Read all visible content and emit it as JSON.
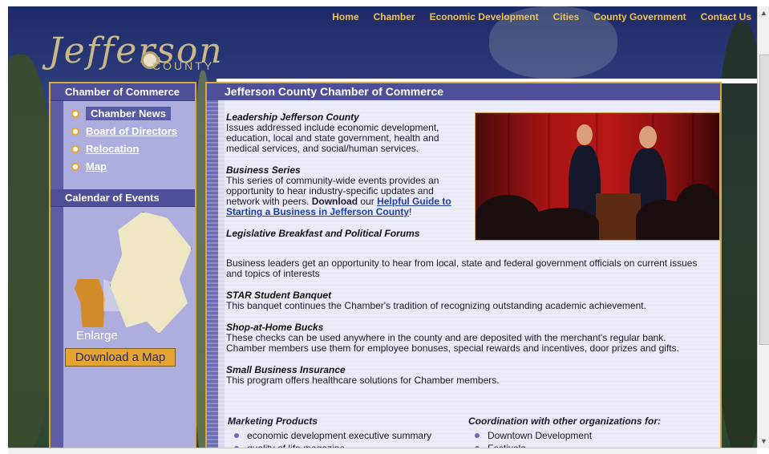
{
  "nav": {
    "items": [
      "Home",
      "Chamber",
      "Economic Development",
      "Cities",
      "County Government",
      "Contact Us"
    ]
  },
  "logo": {
    "script": "Jefferson",
    "county": "COUNTY"
  },
  "sidebar": {
    "heading": "Chamber of Commerce",
    "items": [
      {
        "label": "Chamber News",
        "active": true
      },
      {
        "label": "Board of Directors",
        "active": false
      },
      {
        "label": "Relocation",
        "active": false
      },
      {
        "label": "Map",
        "active": false
      }
    ],
    "calendar_heading": "Calendar of Events",
    "enlarge_label": "Enlarge",
    "download_map_label": "Download a Map"
  },
  "main": {
    "title": "Jefferson County Chamber of Commerce",
    "sections": [
      {
        "title": "Leadership Jefferson County",
        "text": "Issues addressed include economic development, education, local and state government, health and medical services, and social/human services."
      },
      {
        "title": "Business Series",
        "text_before": "This series of community-wide events provides an opportunity to hear industry-specific updates and network with peers. ",
        "download_word": "Download",
        "text_mid": " our ",
        "link": "Helpful Guide to Starting a Business in Jefferson County",
        "text_after": "!"
      },
      {
        "title": "Legislative Breakfast and Political Forums",
        "text": "Business leaders get an opportunity to hear from local, state and federal government officials on current issues and topics of interests"
      },
      {
        "title": "STAR Student Banquet",
        "text": "This banquet continues the Chamber's tradition of recognizing outstanding academic achievement."
      },
      {
        "title": "Shop-at-Home Bucks",
        "text": "These checks can be used anywhere in the county and are deposited with the merchant's regular bank. Chamber members use them for employee bonuses, special rewards and incentives, door prizes and gifts."
      },
      {
        "title": "Small Business Insurance",
        "text": "This program offers healthcare solutions for Chamber members."
      }
    ],
    "marketing": {
      "heading": "Marketing Products",
      "items": [
        "economic development executive summary",
        "quality of life magazine"
      ]
    },
    "coordination": {
      "heading": "Coordination with other organizations for:",
      "items": [
        "Downtown Development",
        "Festivals"
      ]
    }
  },
  "colors": {
    "nav_link": "#f2c24a",
    "panel_header": "#4e4f98",
    "border_gold": "#d7a83c",
    "button_orange": "#e5a431"
  }
}
